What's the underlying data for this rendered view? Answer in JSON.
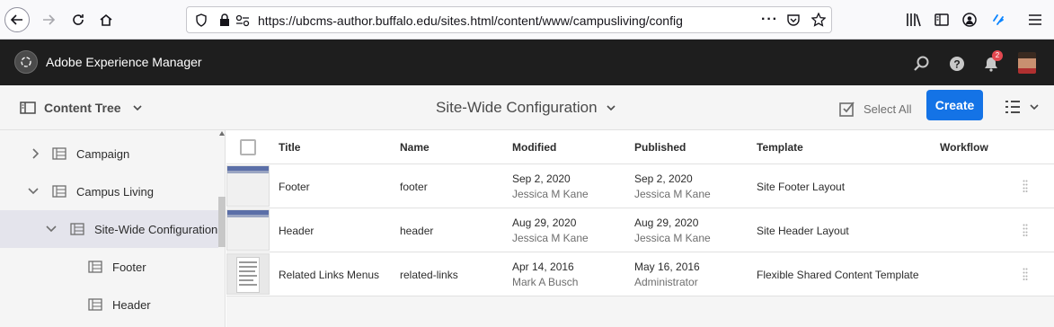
{
  "browser": {
    "url": "https://ubcms-author.buffalo.edu/sites.html/content/www/campusliving/config"
  },
  "header": {
    "app_title": "Adobe Experience Manager",
    "notification_count": "2"
  },
  "action_bar": {
    "rail_label": "Content Tree",
    "page_title": "Site-Wide Configuration",
    "select_all_label": "Select All",
    "create_label": "Create"
  },
  "tree": {
    "items": [
      {
        "label": "Campaign",
        "expanded": false
      },
      {
        "label": "Campus Living",
        "expanded": true
      },
      {
        "label": "Site-Wide Configuration",
        "expanded": true,
        "selected": true
      },
      {
        "label": "Footer"
      },
      {
        "label": "Header"
      }
    ]
  },
  "table": {
    "columns": [
      "Title",
      "Name",
      "Modified",
      "Published",
      "Template",
      "Workflow"
    ],
    "rows": [
      {
        "title": "Footer",
        "name": "footer",
        "modified_date": "Sep 2, 2020",
        "modified_by": "Jessica M Kane",
        "published_date": "Sep 2, 2020",
        "published_by": "Jessica M Kane",
        "template": "Site Footer Layout"
      },
      {
        "title": "Header",
        "name": "header",
        "modified_date": "Aug 29, 2020",
        "modified_by": "Jessica M Kane",
        "published_date": "Aug 29, 2020",
        "published_by": "Jessica M Kane",
        "template": "Site Header Layout"
      },
      {
        "title": "Related Links Menus",
        "name": "related-links",
        "modified_date": "Apr 14, 2016",
        "modified_by": "Mark A Busch",
        "published_date": "May 16, 2016",
        "published_by": "Administrator",
        "template": "Flexible Shared Content Template"
      }
    ]
  },
  "colors": {
    "accent": "#1473e6",
    "header_bg": "#1e1e1e",
    "selected_bg": "#e4e4ec",
    "badge": "#e34850"
  }
}
